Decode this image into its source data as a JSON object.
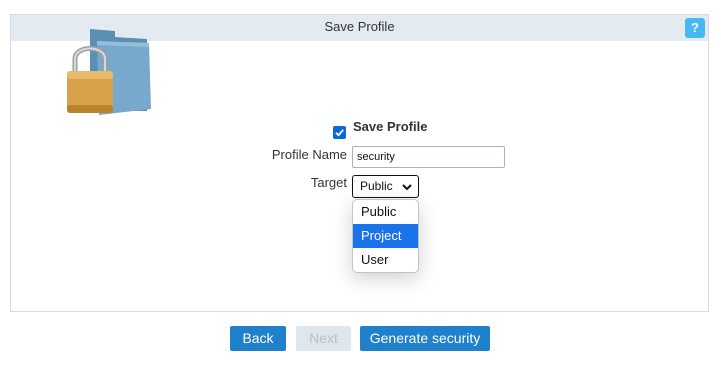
{
  "panel": {
    "title": "Save Profile",
    "help_label": "?"
  },
  "form": {
    "save_profile_checked": true,
    "save_profile_label": "Save Profile",
    "profile_name_label": "Profile Name",
    "profile_name_value": "security",
    "target_label": "Target",
    "target_selected": "Public",
    "target_options": [
      "Public",
      "Project",
      "User"
    ],
    "target_highlighted": "Project"
  },
  "buttons": {
    "back": "Back",
    "next": "Next",
    "generate": "Generate security"
  },
  "colors": {
    "accent": "#1f80cc",
    "header_bg": "#e4eaf1",
    "help_bg": "#48b9f0",
    "highlight": "#1a73e8"
  },
  "icons": {
    "illustration": "padlock-folder-icon",
    "help": "help-icon",
    "checkbox": "checkmark-icon",
    "select_caret": "chevron-down-icon"
  }
}
